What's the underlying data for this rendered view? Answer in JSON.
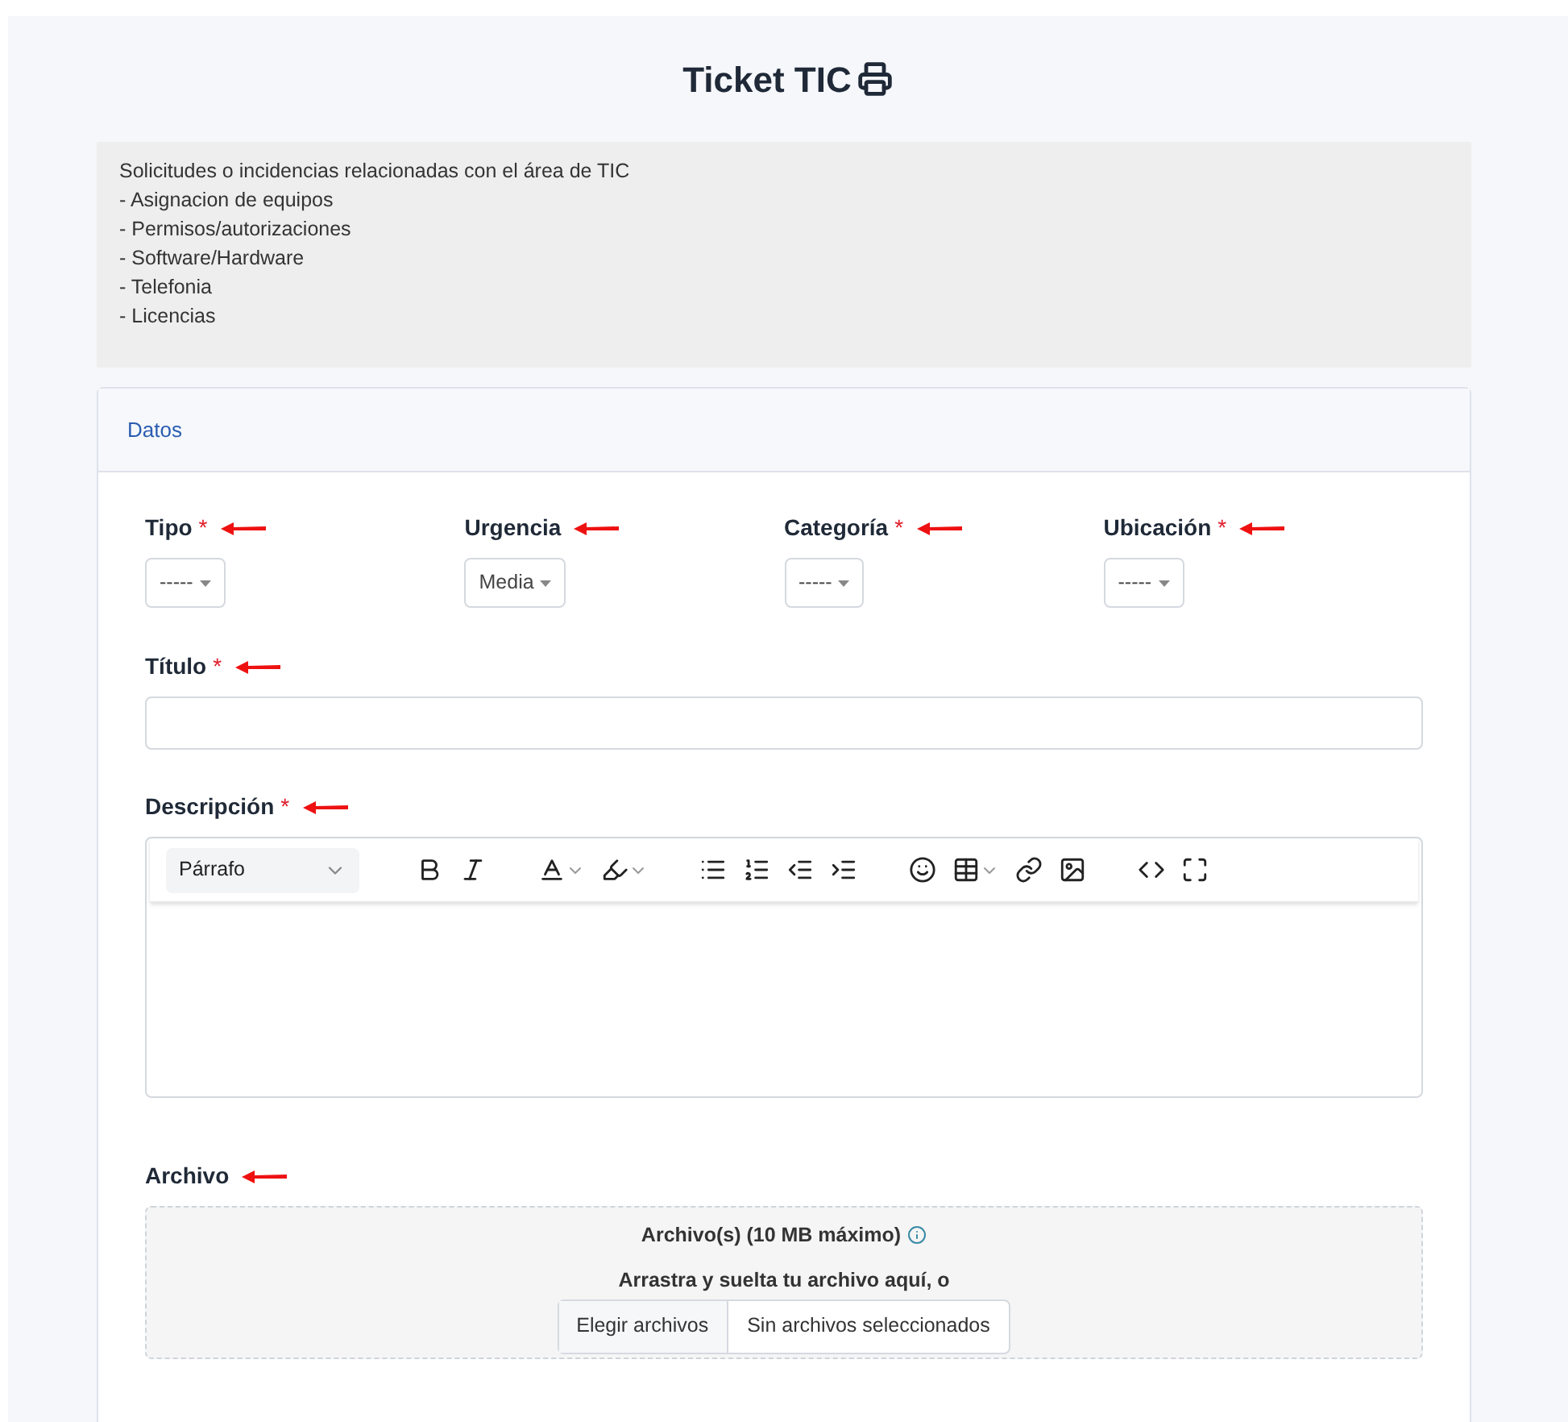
{
  "title": "Ticket TIC",
  "required_mark": "*",
  "description": {
    "heading": "Solicitudes o incidencias relacionadas con el área de TIC",
    "items": [
      "- Asignacion de equipos",
      "- Permisos/autorizaciones",
      "- Software/Hardware",
      "- Telefonia",
      "- Licencias"
    ]
  },
  "card": {
    "header": "Datos"
  },
  "selects": [
    {
      "label": "Tipo",
      "required": true,
      "value": "-----"
    },
    {
      "label": "Urgencia",
      "required": false,
      "value": "Media"
    },
    {
      "label": "Categoría",
      "required": true,
      "value": "-----"
    },
    {
      "label": "Ubicación",
      "required": true,
      "value": "-----"
    }
  ],
  "title_field": {
    "label": "Título",
    "required": true
  },
  "description_field": {
    "label": "Descripción",
    "required": true,
    "block_format": "Párrafo"
  },
  "attachment": {
    "label": "Archivo",
    "required": false,
    "limit": "Archivo(s) (10 MB máximo)",
    "drop_text": "Arrastra y suelta tu archivo aquí, o",
    "button": "Elegir archivos",
    "status": "Sin archivos seleccionados"
  }
}
